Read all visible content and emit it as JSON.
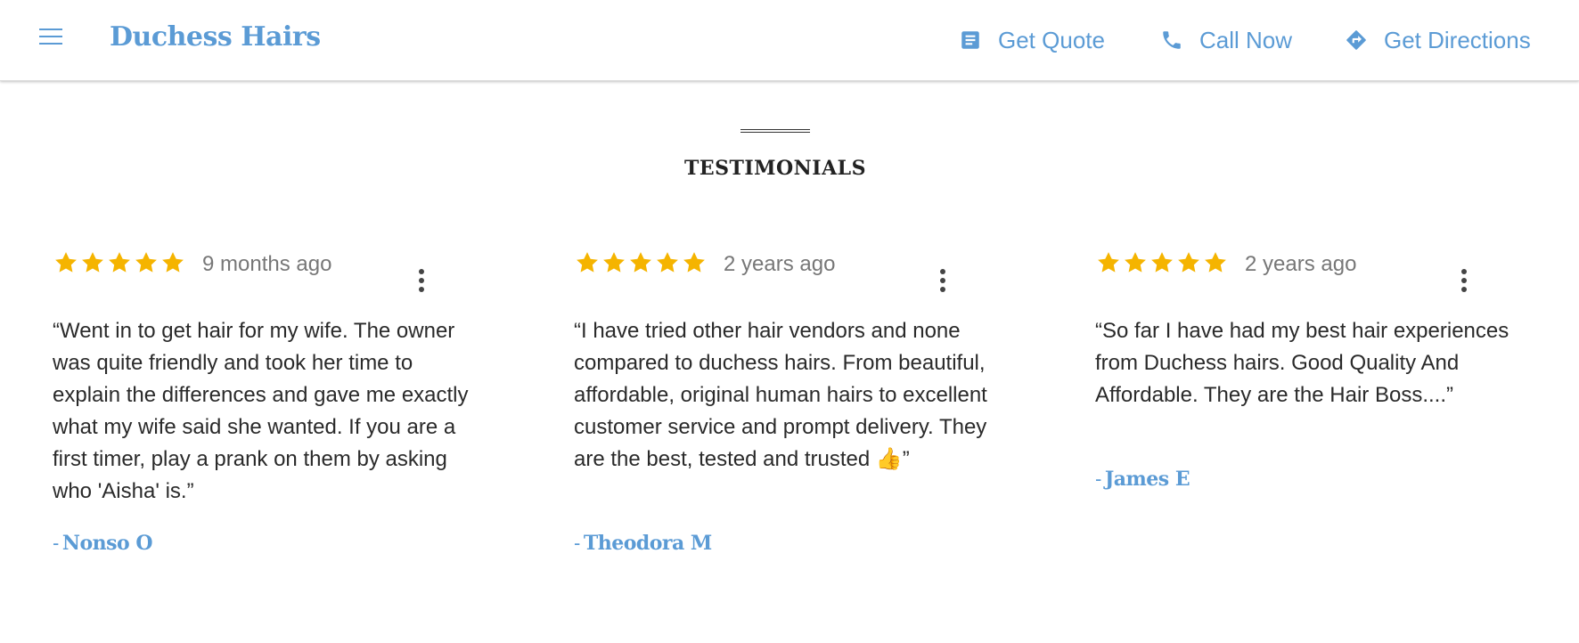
{
  "header": {
    "brand": "Duchess Hairs",
    "nav": {
      "quote_label": "Get Quote",
      "call_label": "Call Now",
      "directions_label": "Get Directions"
    }
  },
  "section": {
    "title": "TESTIMONIALS"
  },
  "colors": {
    "accent": "#5b9bd5",
    "star": "#f5b400",
    "text": "#2a2a2a",
    "muted": "#777777"
  },
  "testimonials": [
    {
      "rating": 5,
      "age": "9 months ago",
      "quote": "“Went in to get hair for my wife. The owner was quite friendly and took her time to explain the differences and gave me exactly what my wife said she wanted. If you are a first timer, play a prank on them by asking who 'Aisha' is.”",
      "author": "Nonso O"
    },
    {
      "rating": 5,
      "age": "2 years ago",
      "quote": "“I have tried other hair vendors and none compared to duchess hairs. From beautiful, affordable, original human hairs to excellent customer service and prompt delivery. They are the best, tested and trusted 👍”",
      "author": "Theodora M"
    },
    {
      "rating": 5,
      "age": "2 years ago",
      "quote": "“So far I have had my best hair experiences from Duchess hairs. Good Quality And Affordable. They are the Hair Boss....”",
      "author": "James E"
    }
  ],
  "author_prefix": "-",
  "icons": {
    "menu": "hamburger-menu-icon",
    "quote": "document-icon",
    "call": "phone-icon",
    "directions": "directions-icon",
    "star": "star-icon",
    "more": "more-vertical-icon"
  }
}
